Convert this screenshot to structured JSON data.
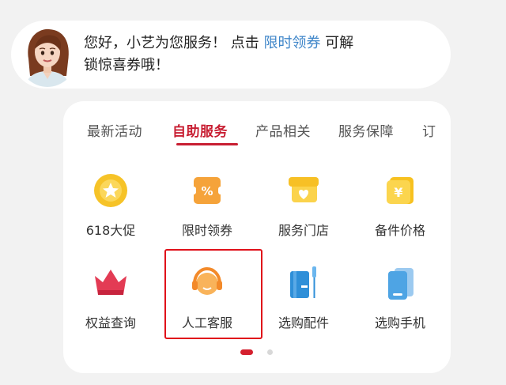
{
  "greeting": {
    "line1_prefix": "您好，小艺为您服务！ 点击 ",
    "link": "限时领券",
    "line1_suffix": " 可解",
    "line2": "锁惊喜券哦！"
  },
  "tabs": [
    {
      "label": "最新活动",
      "active": false
    },
    {
      "label": "自助服务",
      "active": true
    },
    {
      "label": "产品相关",
      "active": false
    },
    {
      "label": "服务保障",
      "active": false
    },
    {
      "label": "订",
      "active": false
    }
  ],
  "grid": [
    {
      "label": "618大促",
      "icon": "gift-icon"
    },
    {
      "label": "限时领券",
      "icon": "coupon-icon"
    },
    {
      "label": "服务门店",
      "icon": "store-icon"
    },
    {
      "label": "备件价格",
      "icon": "price-tag-icon"
    },
    {
      "label": "权益查询",
      "icon": "crown-icon"
    },
    {
      "label": "人工客服",
      "icon": "headset-icon"
    },
    {
      "label": "选购配件",
      "icon": "accessory-icon"
    },
    {
      "label": "选购手机",
      "icon": "phone-icon"
    }
  ],
  "pager": {
    "pages": 2,
    "current": 1
  },
  "colors": {
    "accent": "#c81e32",
    "link": "#3f86c9",
    "highlight": "#e0111a"
  }
}
